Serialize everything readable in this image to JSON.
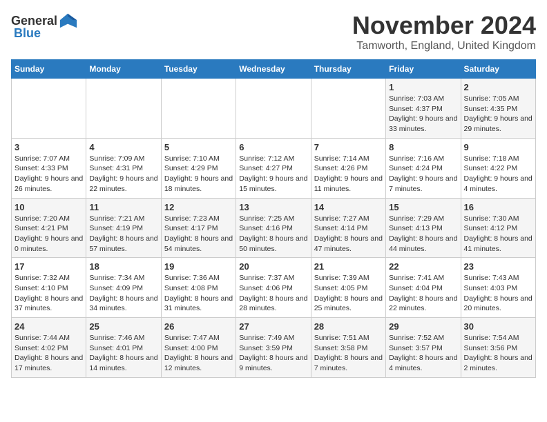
{
  "logo": {
    "general": "General",
    "blue": "Blue"
  },
  "header": {
    "month": "November 2024",
    "location": "Tamworth, England, United Kingdom"
  },
  "weekdays": [
    "Sunday",
    "Monday",
    "Tuesday",
    "Wednesday",
    "Thursday",
    "Friday",
    "Saturday"
  ],
  "weeks": [
    [
      {
        "day": "",
        "info": ""
      },
      {
        "day": "",
        "info": ""
      },
      {
        "day": "",
        "info": ""
      },
      {
        "day": "",
        "info": ""
      },
      {
        "day": "",
        "info": ""
      },
      {
        "day": "1",
        "info": "Sunrise: 7:03 AM\nSunset: 4:37 PM\nDaylight: 9 hours and 33 minutes."
      },
      {
        "day": "2",
        "info": "Sunrise: 7:05 AM\nSunset: 4:35 PM\nDaylight: 9 hours and 29 minutes."
      }
    ],
    [
      {
        "day": "3",
        "info": "Sunrise: 7:07 AM\nSunset: 4:33 PM\nDaylight: 9 hours and 26 minutes."
      },
      {
        "day": "4",
        "info": "Sunrise: 7:09 AM\nSunset: 4:31 PM\nDaylight: 9 hours and 22 minutes."
      },
      {
        "day": "5",
        "info": "Sunrise: 7:10 AM\nSunset: 4:29 PM\nDaylight: 9 hours and 18 minutes."
      },
      {
        "day": "6",
        "info": "Sunrise: 7:12 AM\nSunset: 4:27 PM\nDaylight: 9 hours and 15 minutes."
      },
      {
        "day": "7",
        "info": "Sunrise: 7:14 AM\nSunset: 4:26 PM\nDaylight: 9 hours and 11 minutes."
      },
      {
        "day": "8",
        "info": "Sunrise: 7:16 AM\nSunset: 4:24 PM\nDaylight: 9 hours and 7 minutes."
      },
      {
        "day": "9",
        "info": "Sunrise: 7:18 AM\nSunset: 4:22 PM\nDaylight: 9 hours and 4 minutes."
      }
    ],
    [
      {
        "day": "10",
        "info": "Sunrise: 7:20 AM\nSunset: 4:21 PM\nDaylight: 9 hours and 0 minutes."
      },
      {
        "day": "11",
        "info": "Sunrise: 7:21 AM\nSunset: 4:19 PM\nDaylight: 8 hours and 57 minutes."
      },
      {
        "day": "12",
        "info": "Sunrise: 7:23 AM\nSunset: 4:17 PM\nDaylight: 8 hours and 54 minutes."
      },
      {
        "day": "13",
        "info": "Sunrise: 7:25 AM\nSunset: 4:16 PM\nDaylight: 8 hours and 50 minutes."
      },
      {
        "day": "14",
        "info": "Sunrise: 7:27 AM\nSunset: 4:14 PM\nDaylight: 8 hours and 47 minutes."
      },
      {
        "day": "15",
        "info": "Sunrise: 7:29 AM\nSunset: 4:13 PM\nDaylight: 8 hours and 44 minutes."
      },
      {
        "day": "16",
        "info": "Sunrise: 7:30 AM\nSunset: 4:12 PM\nDaylight: 8 hours and 41 minutes."
      }
    ],
    [
      {
        "day": "17",
        "info": "Sunrise: 7:32 AM\nSunset: 4:10 PM\nDaylight: 8 hours and 37 minutes."
      },
      {
        "day": "18",
        "info": "Sunrise: 7:34 AM\nSunset: 4:09 PM\nDaylight: 8 hours and 34 minutes."
      },
      {
        "day": "19",
        "info": "Sunrise: 7:36 AM\nSunset: 4:08 PM\nDaylight: 8 hours and 31 minutes."
      },
      {
        "day": "20",
        "info": "Sunrise: 7:37 AM\nSunset: 4:06 PM\nDaylight: 8 hours and 28 minutes."
      },
      {
        "day": "21",
        "info": "Sunrise: 7:39 AM\nSunset: 4:05 PM\nDaylight: 8 hours and 25 minutes."
      },
      {
        "day": "22",
        "info": "Sunrise: 7:41 AM\nSunset: 4:04 PM\nDaylight: 8 hours and 22 minutes."
      },
      {
        "day": "23",
        "info": "Sunrise: 7:43 AM\nSunset: 4:03 PM\nDaylight: 8 hours and 20 minutes."
      }
    ],
    [
      {
        "day": "24",
        "info": "Sunrise: 7:44 AM\nSunset: 4:02 PM\nDaylight: 8 hours and 17 minutes."
      },
      {
        "day": "25",
        "info": "Sunrise: 7:46 AM\nSunset: 4:01 PM\nDaylight: 8 hours and 14 minutes."
      },
      {
        "day": "26",
        "info": "Sunrise: 7:47 AM\nSunset: 4:00 PM\nDaylight: 8 hours and 12 minutes."
      },
      {
        "day": "27",
        "info": "Sunrise: 7:49 AM\nSunset: 3:59 PM\nDaylight: 8 hours and 9 minutes."
      },
      {
        "day": "28",
        "info": "Sunrise: 7:51 AM\nSunset: 3:58 PM\nDaylight: 8 hours and 7 minutes."
      },
      {
        "day": "29",
        "info": "Sunrise: 7:52 AM\nSunset: 3:57 PM\nDaylight: 8 hours and 4 minutes."
      },
      {
        "day": "30",
        "info": "Sunrise: 7:54 AM\nSunset: 3:56 PM\nDaylight: 8 hours and 2 minutes."
      }
    ]
  ]
}
